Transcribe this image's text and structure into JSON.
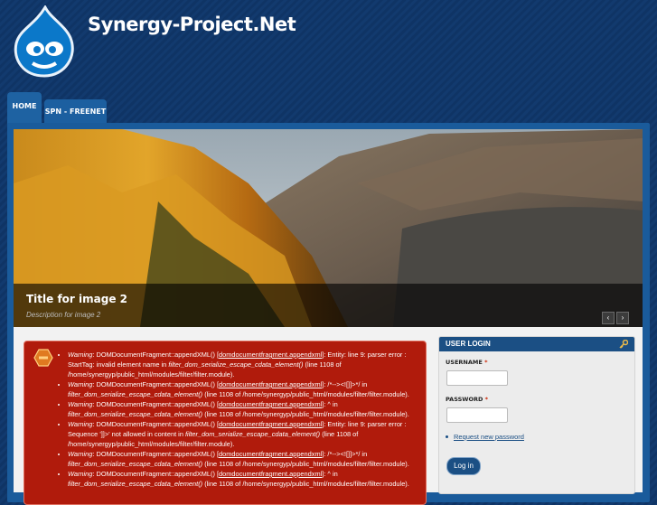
{
  "site": {
    "name": "Synergy-Project.Net"
  },
  "nav": {
    "tabs": [
      {
        "label": "HOME"
      },
      {
        "label": "SPN - FREENET"
      }
    ]
  },
  "slideshow": {
    "title": "Title for image 2",
    "description": "Description for image 2",
    "prev_glyph": "‹",
    "next_glyph": "›"
  },
  "messages": {
    "errors": [
      {
        "prefix": "Warning",
        "text": ": DOMDocumentFragment::appendXML() [",
        "link": "domdocumentfragment.appendxml",
        "rest": "]: Entity: line 9: parser error : StartTag: invalid element name in ",
        "func": "filter_dom_serialize_escape_cdata_element()",
        "tail": " (line 1108 of /home/synergyp/public_html/modules/filter/filter.module)."
      },
      {
        "prefix": "Warning",
        "text": ": DOMDocumentFragment::appendXML() [",
        "link": "domdocumentfragment.appendxml",
        "rest": "]: /*--><![]]>*/ in ",
        "func": "filter_dom_serialize_escape_cdata_element()",
        "tail": " (line 1108 of /home/synergyp/public_html/modules/filter/filter.module)."
      },
      {
        "prefix": "Warning",
        "text": ": DOMDocumentFragment::appendXML() [",
        "link": "domdocumentfragment.appendxml",
        "rest": "]: ^ in ",
        "func": "filter_dom_serialize_escape_cdata_element()",
        "tail": " (line 1108 of /home/synergyp/public_html/modules/filter/filter.module)."
      },
      {
        "prefix": "Warning",
        "text": ": DOMDocumentFragment::appendXML() [",
        "link": "domdocumentfragment.appendxml",
        "rest": "]: Entity: line 9: parser error : Sequence ']]>' not allowed in content in ",
        "func": "filter_dom_serialize_escape_cdata_element()",
        "tail": " (line 1108 of /home/synergyp/public_html/modules/filter/filter.module)."
      },
      {
        "prefix": "Warning",
        "text": ": DOMDocumentFragment::appendXML() [",
        "link": "domdocumentfragment.appendxml",
        "rest": "]: /*--><![]]>*/ in ",
        "func": "filter_dom_serialize_escape_cdata_element()",
        "tail": " (line 1108 of /home/synergyp/public_html/modules/filter/filter.module)."
      },
      {
        "prefix": "Warning",
        "text": ": DOMDocumentFragment::appendXML() [",
        "link": "domdocumentfragment.appendxml",
        "rest": "]: ^ in ",
        "func": "filter_dom_serialize_escape_cdata_element()",
        "tail": " (line 1108 of /home/synergyp/public_html/modules/filter/filter.module)."
      }
    ]
  },
  "login": {
    "title": "USER LOGIN",
    "username_label": "USERNAME",
    "password_label": "PASSWORD",
    "required_mark": "*",
    "request_password": "Request new password",
    "submit": "Log in",
    "username_value": "",
    "password_value": ""
  },
  "icons": {
    "logo": "drupal-drop-logo",
    "error": "error-hexagon-icon",
    "key": "key-icon"
  }
}
